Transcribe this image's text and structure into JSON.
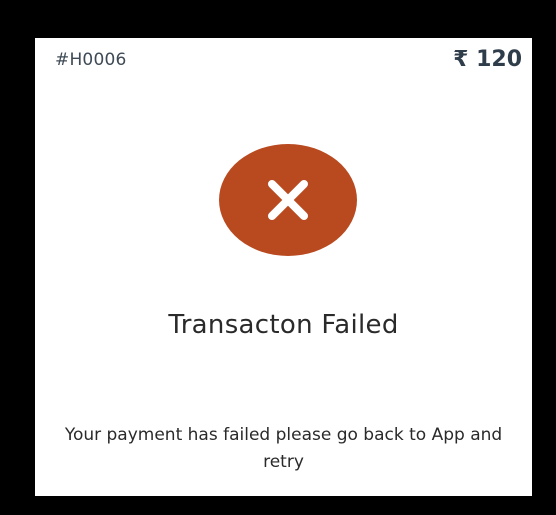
{
  "header": {
    "order_id": "#H0006",
    "amount": "₹ 120"
  },
  "status": {
    "icon": "close-icon",
    "color": "#b94a20",
    "title": "Transacton Failed",
    "message": "Your payment has failed please go back to App and retry"
  }
}
